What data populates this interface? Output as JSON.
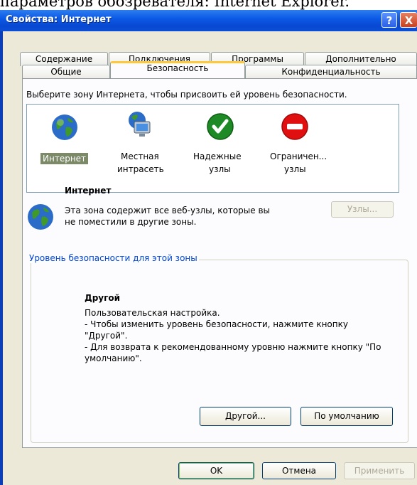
{
  "top_text": "параметров обозревателя: Internet Explorer.",
  "window": {
    "title": "Свойства: Интернет",
    "help_label": "?",
    "close_label": "X"
  },
  "tabs_row1": [
    {
      "label": "Содержание"
    },
    {
      "label": "Подключения"
    },
    {
      "label": "Программы"
    },
    {
      "label": "Дополнительно"
    }
  ],
  "tabs_row2": [
    {
      "label": "Общие"
    },
    {
      "label": "Безопасность",
      "active": true
    },
    {
      "label": "Конфиденциальность"
    }
  ],
  "security": {
    "instruction": "Выберите зону Интернета, чтобы присвоить ей уровень безопасности.",
    "zones": [
      {
        "label": "Интернет",
        "icon": "globe-icon",
        "selected": true
      },
      {
        "label1": "Местная",
        "label2": "интрасеть",
        "icon": "intranet-icon"
      },
      {
        "label1": "Надежные",
        "label2": "узлы",
        "icon": "trusted-check-icon",
        "color": "#1e8a26"
      },
      {
        "label1": "Ограничен...",
        "label2": "узлы",
        "icon": "restricted-icon",
        "color": "#e01010"
      }
    ],
    "selected_zone": {
      "title": "Интернет",
      "description": "Эта зона содержит все веб-узлы, которые вы не поместили в другие зоны."
    },
    "sites_button": "Узлы...",
    "level_group": {
      "label": "Уровень безопасности для этой зоны",
      "title": "Другой",
      "line1": "Пользовательская настройка.",
      "line2": "- Чтобы изменить уровень безопасности, нажмите кнопку \"Другой\".",
      "line3": "- Для возврата к рекомендованному уровню нажмите кнопку \"По умолчанию\".",
      "custom_button": "Другой...",
      "default_button": "По умолчанию"
    }
  },
  "footer": {
    "ok": "OK",
    "cancel": "Отмена",
    "apply": "Применить"
  },
  "colors": {
    "accent_tab": "#ffc83c",
    "group_label": "#0046d5",
    "selection": "#7c8a68"
  }
}
